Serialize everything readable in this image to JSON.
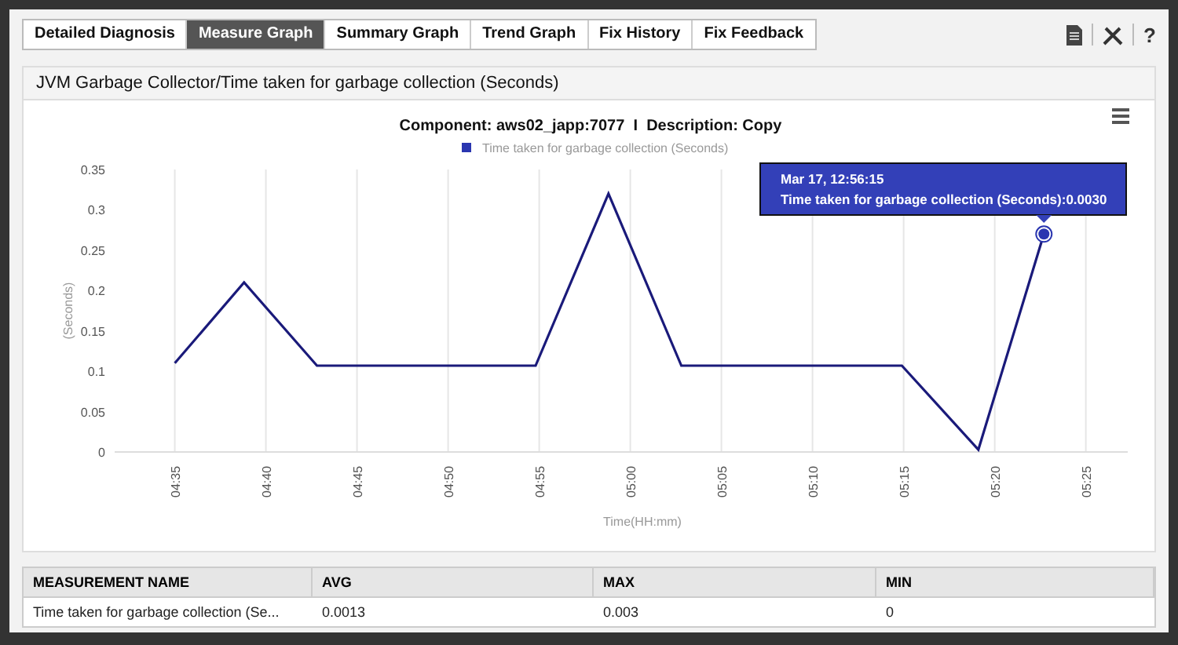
{
  "tabs": [
    {
      "label": "Detailed Diagnosis",
      "selected": false
    },
    {
      "label": "Measure Graph",
      "selected": true
    },
    {
      "label": "Summary Graph",
      "selected": false
    },
    {
      "label": "Trend Graph",
      "selected": false
    },
    {
      "label": "Fix History",
      "selected": false
    },
    {
      "label": "Fix Feedback",
      "selected": false
    }
  ],
  "toolbar": {
    "help": "?"
  },
  "panel": {
    "title": "JVM Garbage Collector/Time taken for garbage collection (Seconds)",
    "chart": {
      "subtitle": "Component: aws02_japp:7077  I  Description: Copy",
      "tooltip": {
        "title": "Mar 17, 12:56:15",
        "text": "Time taken for garbage collection (Seconds):0.0030"
      },
      "chart_data": {
        "type": "line",
        "xlabel": "Time(HH:mm)",
        "ylabel": "(Seconds)",
        "grid": true,
        "x": [
          275,
          278.8,
          282.8,
          294.8,
          298.8,
          302.8,
          314.9,
          319.1,
          322.7
        ],
        "series": [
          {
            "name": "Time taken for garbage collection (Seconds)",
            "color": "#1a1a7a",
            "values": [
              0.11,
              0.21,
              0.107,
              0.107,
              0.32,
              0.107,
              0.107,
              0.003,
              0.27
            ]
          }
        ],
        "xlim": [
          271.7,
          327.3
        ],
        "ylim": [
          0,
          0.35
        ],
        "xticks": [
          {
            "value": 275,
            "label": "04:35"
          },
          {
            "value": 280,
            "label": "04:40"
          },
          {
            "value": 285,
            "label": "04:45"
          },
          {
            "value": 290,
            "label": "04:50"
          },
          {
            "value": 295,
            "label": "04:55"
          },
          {
            "value": 300,
            "label": "05:00"
          },
          {
            "value": 305,
            "label": "05:05"
          },
          {
            "value": 310,
            "label": "05:10"
          },
          {
            "value": 315,
            "label": "05:15"
          },
          {
            "value": 320,
            "label": "05:20"
          },
          {
            "value": 325,
            "label": "05:25"
          }
        ],
        "yticks": [
          {
            "value": 0,
            "label": "0"
          },
          {
            "value": 0.05,
            "label": "0.05"
          },
          {
            "value": 0.1,
            "label": "0.1"
          },
          {
            "value": 0.15,
            "label": "0.15"
          },
          {
            "value": 0.2,
            "label": "0.2"
          },
          {
            "value": 0.25,
            "label": "0.25"
          },
          {
            "value": 0.3,
            "label": "0.3"
          },
          {
            "value": 0.35,
            "label": "0.35"
          }
        ]
      }
    }
  },
  "table": {
    "columns": [
      "MEASUREMENT NAME",
      "AVG",
      "MAX",
      "MIN"
    ],
    "rows": [
      [
        "Time taken for garbage collection (Se...",
        "0.0013",
        "0.003",
        "0"
      ]
    ]
  }
}
